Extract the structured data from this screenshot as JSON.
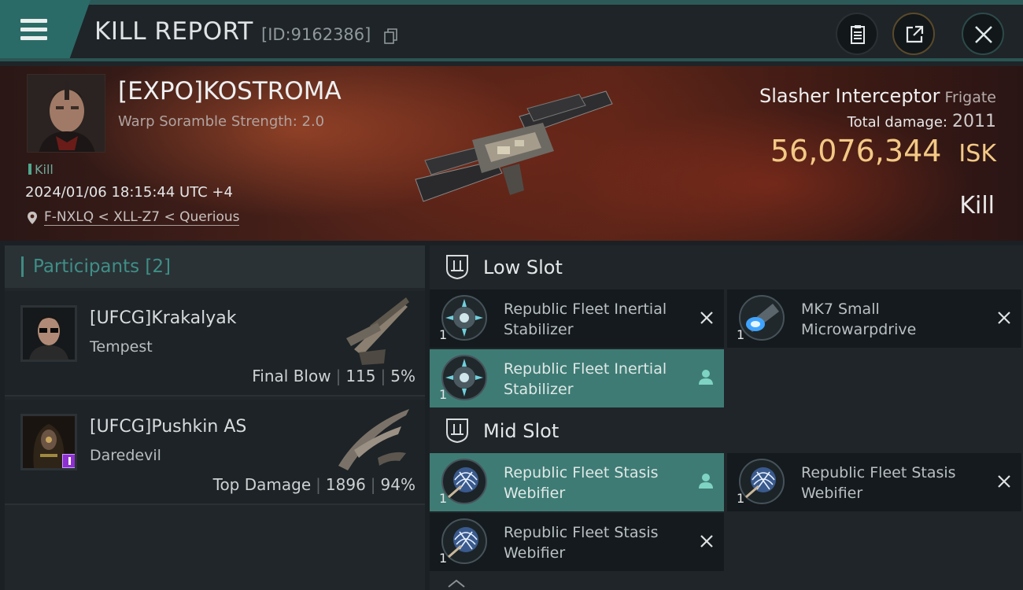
{
  "header": {
    "title": "KILL REPORT",
    "report_id": "[ID:9162386]",
    "icons": {
      "menu": "hamburger-menu-icon",
      "copy": "copy-icon",
      "clipboard": "clipboard-icon",
      "share": "share-icon",
      "close": "close-icon"
    }
  },
  "victim": {
    "name": "[EXPO]KOSTROMA",
    "subtitle": "Warp Soramble Strength: 2.0",
    "tag": "Kill",
    "timestamp": "2024/01/06 18:15:44 UTC +4",
    "location": "F-NXLQ < XLL-Z7 < Querious",
    "ship_name": "Slasher Interceptor",
    "ship_class": "Frigate",
    "total_damage_label": "Total damage:",
    "total_damage": "2011",
    "isk_value": "56,076,344",
    "isk_unit": "ISK",
    "result": "Kill"
  },
  "participants": {
    "title": "Participants",
    "count": "[2]",
    "rows": [
      {
        "name": "[UFCG]Krakalyak",
        "ship": "Tempest",
        "role": "Final Blow",
        "damage": "115",
        "percent": "5%"
      },
      {
        "name": "[UFCG]Pushkin AS",
        "ship": "Daredevil",
        "role": "Top Damage",
        "damage": "1896",
        "percent": "94%"
      }
    ]
  },
  "fitting": {
    "low_slot": {
      "label": "Low Slot",
      "modules": [
        {
          "name": "Republic Fleet Inertial Stabilizer",
          "qty": "1",
          "status": "destroyed"
        },
        {
          "name": "MK7 Small Microwarpdrive",
          "qty": "1",
          "status": "destroyed"
        },
        {
          "name": "Republic Fleet Inertial Stabilizer",
          "qty": "1",
          "status": "dropped"
        }
      ]
    },
    "mid_slot": {
      "label": "Mid Slot",
      "modules": [
        {
          "name": "Republic Fleet Stasis Webifier",
          "qty": "1",
          "status": "dropped"
        },
        {
          "name": "Republic Fleet Stasis Webifier",
          "qty": "1",
          "status": "destroyed"
        },
        {
          "name": "Republic Fleet Stasis Webifier",
          "qty": "1",
          "status": "destroyed"
        }
      ]
    }
  },
  "colors": {
    "accent_teal": "#3e7b74",
    "isk_gold": "#f3c985",
    "background": "#1b2024"
  }
}
